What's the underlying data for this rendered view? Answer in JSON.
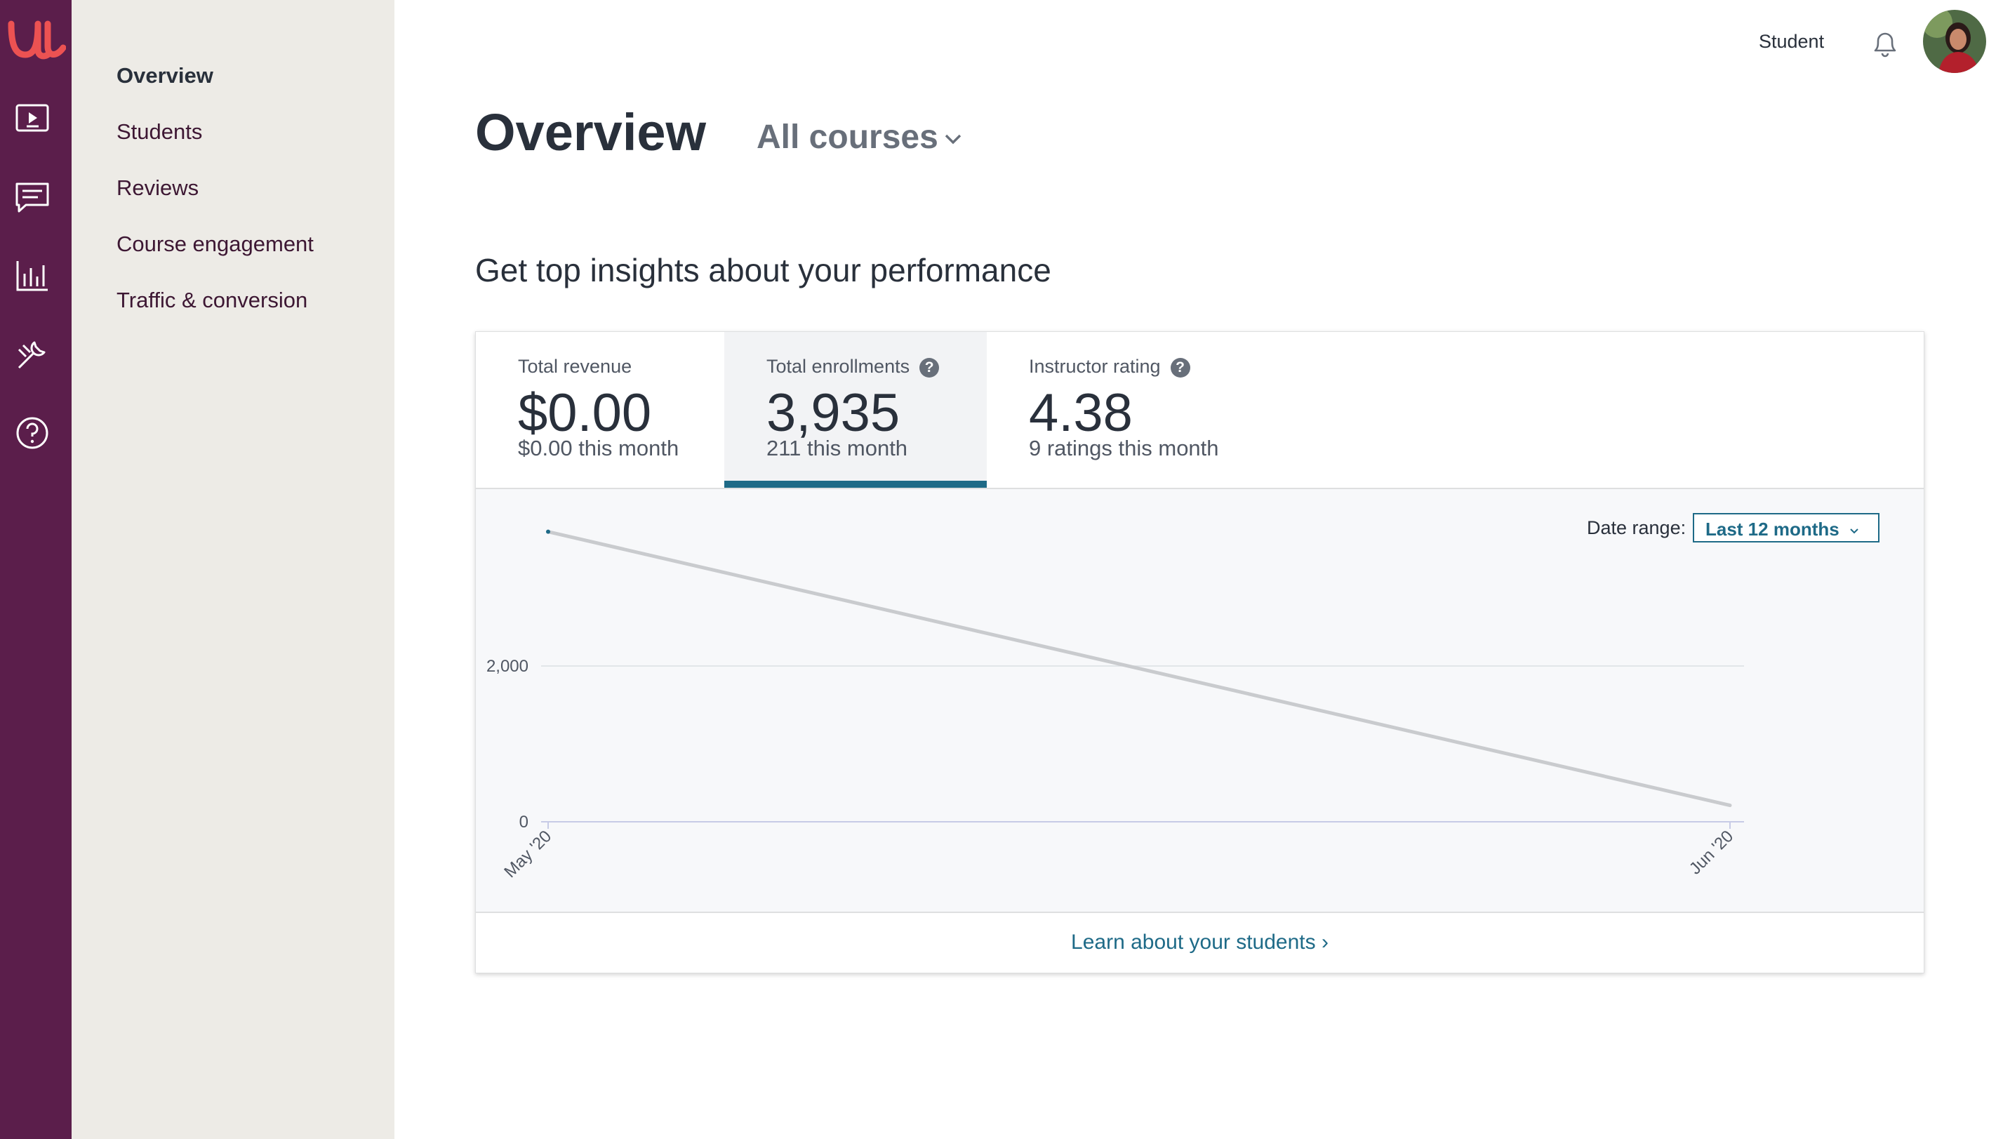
{
  "rail": {
    "logo_letter": "u",
    "icons": [
      "course-video-icon",
      "chat-icon",
      "bar-chart-icon",
      "tools-icon",
      "help-circle-icon"
    ],
    "background": "#5b1e4b"
  },
  "subnav": {
    "items": [
      {
        "label": "Overview",
        "active": true
      },
      {
        "label": "Students",
        "active": false
      },
      {
        "label": "Reviews",
        "active": false
      },
      {
        "label": "Course engagement",
        "active": false
      },
      {
        "label": "Traffic & conversion",
        "active": false
      }
    ]
  },
  "topbar": {
    "student_label": "Student"
  },
  "page": {
    "title": "Overview",
    "course_filter": "All courses",
    "section_title": "Get top insights about your performance"
  },
  "tabs": [
    {
      "label": "Total revenue",
      "value": "$0.00",
      "sub": "$0.00 this month",
      "help": false,
      "active": false
    },
    {
      "label": "Total enrollments",
      "value": "3,935",
      "sub": "211 this month",
      "help": true,
      "active": true
    },
    {
      "label": "Instructor rating",
      "value": "4.38",
      "sub": "9 ratings this month",
      "help": true,
      "active": false
    }
  ],
  "help_glyph": "?",
  "date_range": {
    "label": "Date range:",
    "selected": "Last 12 months"
  },
  "chart_data": {
    "type": "line",
    "x": [
      "May '20",
      "Jun '20"
    ],
    "series": [
      {
        "values": [
          3724,
          211
        ]
      }
    ],
    "y_ticks": [
      0,
      2000
    ],
    "y_tick_labels": [
      "0",
      "2,000"
    ],
    "ylim": [
      0,
      4000
    ],
    "grid": true,
    "line_color": "#c9cbce",
    "marker_color": "#1e6a87"
  },
  "footer_link": "Learn about your students ›",
  "colors": {
    "accent": "#1e6a87",
    "brand": "#ec5252"
  }
}
